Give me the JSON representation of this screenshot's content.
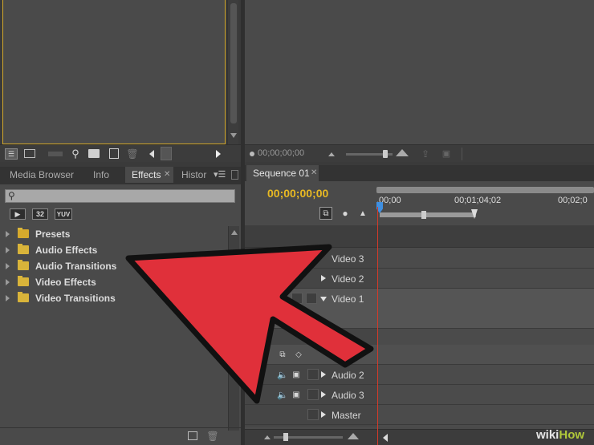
{
  "source_monitor": {
    "icons": [
      "list-view-icon",
      "icon-view-icon",
      "zoom-slider-icon",
      "search-icon",
      "new-bin-icon",
      "new-item-icon",
      "clear-icon",
      "scroll-left-icon",
      "scroll-right-icon"
    ]
  },
  "program_monitor": {
    "timecode": "00;00;00;00"
  },
  "project_panel": {
    "tabs": [
      {
        "label": "Media Browser"
      },
      {
        "label": "Info"
      },
      {
        "label": "Effects"
      },
      {
        "label": "Histor"
      }
    ],
    "search": {
      "value": ""
    },
    "filter_buttons": [
      "32",
      "YUV"
    ],
    "tree": [
      {
        "label": "Presets"
      },
      {
        "label": "Audio Effects"
      },
      {
        "label": "Audio Transitions"
      },
      {
        "label": "Video Effects"
      },
      {
        "label": "Video Transitions"
      }
    ]
  },
  "timeline": {
    "tab_label": "Sequence 01",
    "timecode": "00;00;00;00",
    "ruler": [
      ",00;00",
      "00;01;04;02",
      "00;02;0"
    ],
    "tracks": [
      {
        "label": "Video 3"
      },
      {
        "label": "Video 2"
      },
      {
        "label": "Video 1"
      },
      {
        "label": "Audio 2"
      },
      {
        "label": "Audio 3"
      },
      {
        "label": "Master"
      }
    ]
  },
  "watermark": {
    "wiki": "wiki",
    "how": "How"
  },
  "colors": {
    "accent_yellow": "#e8b923",
    "playhead_red": "#d23a2a",
    "arrow_red": "#e0303a",
    "playhead_blue": "#3f8fe0"
  }
}
